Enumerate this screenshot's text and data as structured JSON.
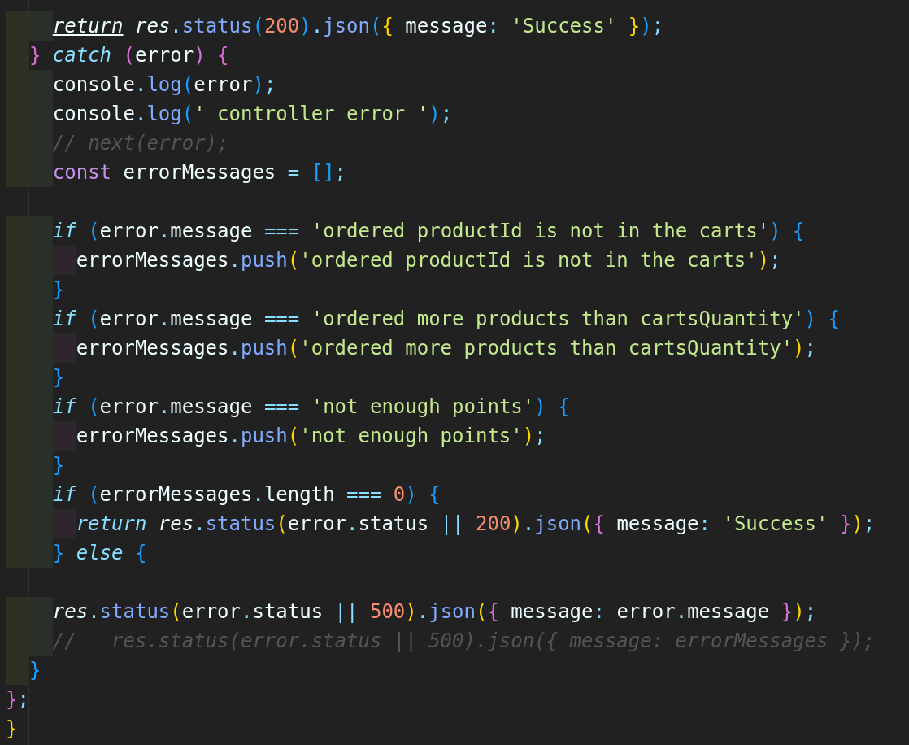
{
  "editor": {
    "lines": [
      {
        "kind": "code",
        "indent_guides": [
          {
            "color": "#2f2f23"
          },
          {
            "color": "#29302a"
          }
        ],
        "tokens": [
          {
            "text": "return",
            "kind": "keyword-link"
          },
          {
            "text": " res",
            "kind": "italic"
          },
          {
            "text": ".",
            "kind": "punct"
          },
          {
            "text": "status",
            "kind": "method"
          },
          {
            "text": "(",
            "kind": "bracket-blue"
          },
          {
            "text": "200",
            "kind": "number"
          },
          {
            "text": ")",
            "kind": "bracket-blue"
          },
          {
            "text": ".",
            "kind": "punct"
          },
          {
            "text": "json",
            "kind": "method"
          },
          {
            "text": "(",
            "kind": "bracket-blue"
          },
          {
            "text": "{",
            "kind": "bracket-yellow"
          },
          {
            "text": " message",
            "kind": "plain"
          },
          {
            "text": ":",
            "kind": "punct"
          },
          {
            "text": " 'Success'",
            "kind": "string"
          },
          {
            "text": " }",
            "kind": "bracket-yellow"
          },
          {
            "text": ")",
            "kind": "bracket-blue"
          },
          {
            "text": ";",
            "kind": "punct"
          }
        ]
      },
      {
        "kind": "code",
        "indent_guides": [
          {
            "color": "#2f2f23"
          }
        ],
        "tokens": [
          {
            "text": "}",
            "kind": "bracket-purple"
          },
          {
            "text": " catch",
            "kind": "keyword"
          },
          {
            "text": " (",
            "kind": "bracket-purple"
          },
          {
            "text": "error",
            "kind": "plain"
          },
          {
            "text": ")",
            "kind": "bracket-purple"
          },
          {
            "text": " {",
            "kind": "bracket-purple"
          }
        ]
      },
      {
        "kind": "code",
        "indent_guides": [
          {
            "color": "#2f2f23"
          },
          {
            "color": "#29302a"
          }
        ],
        "tokens": [
          {
            "text": "console",
            "kind": "plain"
          },
          {
            "text": ".",
            "kind": "punct"
          },
          {
            "text": "log",
            "kind": "method"
          },
          {
            "text": "(",
            "kind": "bracket-blue"
          },
          {
            "text": "error",
            "kind": "plain"
          },
          {
            "text": ")",
            "kind": "bracket-blue"
          },
          {
            "text": ";",
            "kind": "punct"
          }
        ]
      },
      {
        "kind": "code",
        "indent_guides": [
          {
            "color": "#2f2f23"
          },
          {
            "color": "#29302a"
          }
        ],
        "tokens": [
          {
            "text": "console",
            "kind": "plain"
          },
          {
            "text": ".",
            "kind": "punct"
          },
          {
            "text": "log",
            "kind": "method"
          },
          {
            "text": "(",
            "kind": "bracket-blue"
          },
          {
            "text": "' controller error '",
            "kind": "string"
          },
          {
            "text": ")",
            "kind": "bracket-blue"
          },
          {
            "text": ";",
            "kind": "punct"
          }
        ]
      },
      {
        "kind": "code",
        "indent_guides": [
          {
            "color": "#2f2f23"
          },
          {
            "color": "#29302a"
          }
        ],
        "tokens": [
          {
            "text": "// next(error);",
            "kind": "comment"
          }
        ]
      },
      {
        "kind": "code",
        "indent_guides": [
          {
            "color": "#2f2f23"
          },
          {
            "color": "#29302a"
          }
        ],
        "tokens": [
          {
            "text": "const",
            "kind": "storage"
          },
          {
            "text": " errorMessages",
            "kind": "plain"
          },
          {
            "text": " =",
            "kind": "punct"
          },
          {
            "text": " []",
            "kind": "bracket-blue"
          },
          {
            "text": ";",
            "kind": "punct"
          }
        ]
      },
      {
        "kind": "blank"
      },
      {
        "kind": "code",
        "indent_guides": [
          {
            "color": "#2f2f23"
          },
          {
            "color": "#29302a"
          }
        ],
        "tokens": [
          {
            "text": "if",
            "kind": "keyword"
          },
          {
            "text": " (",
            "kind": "bracket-blue"
          },
          {
            "text": "error",
            "kind": "plain"
          },
          {
            "text": ".",
            "kind": "punct"
          },
          {
            "text": "message",
            "kind": "plain"
          },
          {
            "text": " ===",
            "kind": "punct"
          },
          {
            "text": " 'ordered productId is not in the carts'",
            "kind": "string"
          },
          {
            "text": ")",
            "kind": "bracket-blue"
          },
          {
            "text": " {",
            "kind": "bracket-blue"
          }
        ]
      },
      {
        "kind": "code",
        "indent_guides": [
          {
            "color": "#2f2f23"
          },
          {
            "color": "#29302a"
          },
          {
            "color": "#2e262c"
          }
        ],
        "tokens": [
          {
            "text": "errorMessages",
            "kind": "plain"
          },
          {
            "text": ".",
            "kind": "punct"
          },
          {
            "text": "push",
            "kind": "method"
          },
          {
            "text": "(",
            "kind": "bracket-yellow"
          },
          {
            "text": "'ordered productId is not in the carts'",
            "kind": "string"
          },
          {
            "text": ")",
            "kind": "bracket-yellow"
          },
          {
            "text": ";",
            "kind": "punct"
          }
        ]
      },
      {
        "kind": "code",
        "indent_guides": [
          {
            "color": "#2f2f23"
          },
          {
            "color": "#29302a"
          }
        ],
        "tokens": [
          {
            "text": "}",
            "kind": "bracket-blue"
          }
        ]
      },
      {
        "kind": "code",
        "indent_guides": [
          {
            "color": "#2f2f23"
          },
          {
            "color": "#29302a"
          }
        ],
        "tokens": [
          {
            "text": "if",
            "kind": "keyword"
          },
          {
            "text": " (",
            "kind": "bracket-blue"
          },
          {
            "text": "error",
            "kind": "plain"
          },
          {
            "text": ".",
            "kind": "punct"
          },
          {
            "text": "message",
            "kind": "plain"
          },
          {
            "text": " ===",
            "kind": "punct"
          },
          {
            "text": " 'ordered more products than cartsQuantity'",
            "kind": "string"
          },
          {
            "text": ")",
            "kind": "bracket-blue"
          },
          {
            "text": " {",
            "kind": "bracket-blue"
          }
        ]
      },
      {
        "kind": "code",
        "indent_guides": [
          {
            "color": "#2f2f23"
          },
          {
            "color": "#29302a"
          },
          {
            "color": "#2e262c"
          }
        ],
        "tokens": [
          {
            "text": "errorMessages",
            "kind": "plain"
          },
          {
            "text": ".",
            "kind": "punct"
          },
          {
            "text": "push",
            "kind": "method"
          },
          {
            "text": "(",
            "kind": "bracket-yellow"
          },
          {
            "text": "'ordered more products than cartsQuantity'",
            "kind": "string"
          },
          {
            "text": ")",
            "kind": "bracket-yellow"
          },
          {
            "text": ";",
            "kind": "punct"
          }
        ]
      },
      {
        "kind": "code",
        "indent_guides": [
          {
            "color": "#2f2f23"
          },
          {
            "color": "#29302a"
          }
        ],
        "tokens": [
          {
            "text": "}",
            "kind": "bracket-blue"
          }
        ]
      },
      {
        "kind": "code",
        "indent_guides": [
          {
            "color": "#2f2f23"
          },
          {
            "color": "#29302a"
          }
        ],
        "tokens": [
          {
            "text": "if",
            "kind": "keyword"
          },
          {
            "text": " (",
            "kind": "bracket-blue"
          },
          {
            "text": "error",
            "kind": "plain"
          },
          {
            "text": ".",
            "kind": "punct"
          },
          {
            "text": "message",
            "kind": "plain"
          },
          {
            "text": " ===",
            "kind": "punct"
          },
          {
            "text": " 'not enough points'",
            "kind": "string"
          },
          {
            "text": ")",
            "kind": "bracket-blue"
          },
          {
            "text": " {",
            "kind": "bracket-blue"
          }
        ]
      },
      {
        "kind": "code",
        "indent_guides": [
          {
            "color": "#2f2f23"
          },
          {
            "color": "#29302a"
          },
          {
            "color": "#2e262c"
          }
        ],
        "tokens": [
          {
            "text": "errorMessages",
            "kind": "plain"
          },
          {
            "text": ".",
            "kind": "punct"
          },
          {
            "text": "push",
            "kind": "method"
          },
          {
            "text": "(",
            "kind": "bracket-yellow"
          },
          {
            "text": "'not enough points'",
            "kind": "string"
          },
          {
            "text": ")",
            "kind": "bracket-yellow"
          },
          {
            "text": ";",
            "kind": "punct"
          }
        ]
      },
      {
        "kind": "code",
        "indent_guides": [
          {
            "color": "#2f2f23"
          },
          {
            "color": "#29302a"
          }
        ],
        "tokens": [
          {
            "text": "}",
            "kind": "bracket-blue"
          }
        ]
      },
      {
        "kind": "code",
        "indent_guides": [
          {
            "color": "#2f2f23"
          },
          {
            "color": "#29302a"
          }
        ],
        "tokens": [
          {
            "text": "if",
            "kind": "keyword"
          },
          {
            "text": " (",
            "kind": "bracket-blue"
          },
          {
            "text": "errorMessages",
            "kind": "plain"
          },
          {
            "text": ".",
            "kind": "punct"
          },
          {
            "text": "length",
            "kind": "plain"
          },
          {
            "text": " ===",
            "kind": "punct"
          },
          {
            "text": " 0",
            "kind": "number"
          },
          {
            "text": ")",
            "kind": "bracket-blue"
          },
          {
            "text": " {",
            "kind": "bracket-blue"
          }
        ]
      },
      {
        "kind": "code",
        "indent_guides": [
          {
            "color": "#2f2f23"
          },
          {
            "color": "#29302a"
          },
          {
            "color": "#2e262c"
          }
        ],
        "tokens": [
          {
            "text": "return",
            "kind": "keyword"
          },
          {
            "text": " res",
            "kind": "italic"
          },
          {
            "text": ".",
            "kind": "punct"
          },
          {
            "text": "status",
            "kind": "method"
          },
          {
            "text": "(",
            "kind": "bracket-yellow"
          },
          {
            "text": "error",
            "kind": "plain"
          },
          {
            "text": ".",
            "kind": "punct"
          },
          {
            "text": "status",
            "kind": "plain"
          },
          {
            "text": " ||",
            "kind": "punct"
          },
          {
            "text": " 200",
            "kind": "number"
          },
          {
            "text": ")",
            "kind": "bracket-yellow"
          },
          {
            "text": ".",
            "kind": "punct"
          },
          {
            "text": "json",
            "kind": "method"
          },
          {
            "text": "(",
            "kind": "bracket-yellow"
          },
          {
            "text": "{",
            "kind": "bracket-purple"
          },
          {
            "text": " message",
            "kind": "plain"
          },
          {
            "text": ":",
            "kind": "punct"
          },
          {
            "text": " 'Success'",
            "kind": "string"
          },
          {
            "text": " }",
            "kind": "bracket-purple"
          },
          {
            "text": ")",
            "kind": "bracket-yellow"
          },
          {
            "text": ";",
            "kind": "punct"
          }
        ]
      },
      {
        "kind": "code",
        "indent_guides": [
          {
            "color": "#2f2f23"
          },
          {
            "color": "#29302a"
          }
        ],
        "tokens": [
          {
            "text": "}",
            "kind": "bracket-blue"
          },
          {
            "text": " else",
            "kind": "keyword"
          },
          {
            "text": " {",
            "kind": "bracket-blue"
          }
        ]
      },
      {
        "kind": "blank"
      },
      {
        "kind": "code",
        "indent_guides": [
          {
            "color": "#2f2f23"
          },
          {
            "color": "#29302a"
          }
        ],
        "tokens": [
          {
            "text": "res",
            "kind": "italic"
          },
          {
            "text": ".",
            "kind": "punct"
          },
          {
            "text": "status",
            "kind": "method"
          },
          {
            "text": "(",
            "kind": "bracket-yellow"
          },
          {
            "text": "error",
            "kind": "plain"
          },
          {
            "text": ".",
            "kind": "punct"
          },
          {
            "text": "status",
            "kind": "plain"
          },
          {
            "text": " ||",
            "kind": "punct"
          },
          {
            "text": " 500",
            "kind": "number"
          },
          {
            "text": ")",
            "kind": "bracket-yellow"
          },
          {
            "text": ".",
            "kind": "punct"
          },
          {
            "text": "json",
            "kind": "method"
          },
          {
            "text": "(",
            "kind": "bracket-yellow"
          },
          {
            "text": "{",
            "kind": "bracket-purple"
          },
          {
            "text": " message",
            "kind": "plain"
          },
          {
            "text": ":",
            "kind": "punct"
          },
          {
            "text": " error",
            "kind": "plain"
          },
          {
            "text": ".",
            "kind": "punct"
          },
          {
            "text": "message",
            "kind": "plain"
          },
          {
            "text": " }",
            "kind": "bracket-purple"
          },
          {
            "text": ")",
            "kind": "bracket-yellow"
          },
          {
            "text": ";",
            "kind": "punct"
          }
        ]
      },
      {
        "kind": "code",
        "indent_guides": [
          {
            "color": "#2f2f23"
          },
          {
            "color": "#29302a"
          }
        ],
        "tokens": [
          {
            "text": "//   res.status(error.status || 500).json({ message: errorMessages });",
            "kind": "comment"
          }
        ]
      },
      {
        "kind": "code",
        "indent_guides": [
          {
            "color": "#2f2f23"
          }
        ],
        "tokens": [
          {
            "text": "}",
            "kind": "bracket-blue"
          }
        ]
      },
      {
        "kind": "code",
        "tokens": [
          {
            "text": "}",
            "kind": "bracket-purple"
          },
          {
            "text": ";",
            "kind": "punct"
          }
        ]
      },
      {
        "kind": "code",
        "tokens": [
          {
            "text": "}",
            "kind": "bracket-yellow"
          }
        ]
      }
    ]
  }
}
